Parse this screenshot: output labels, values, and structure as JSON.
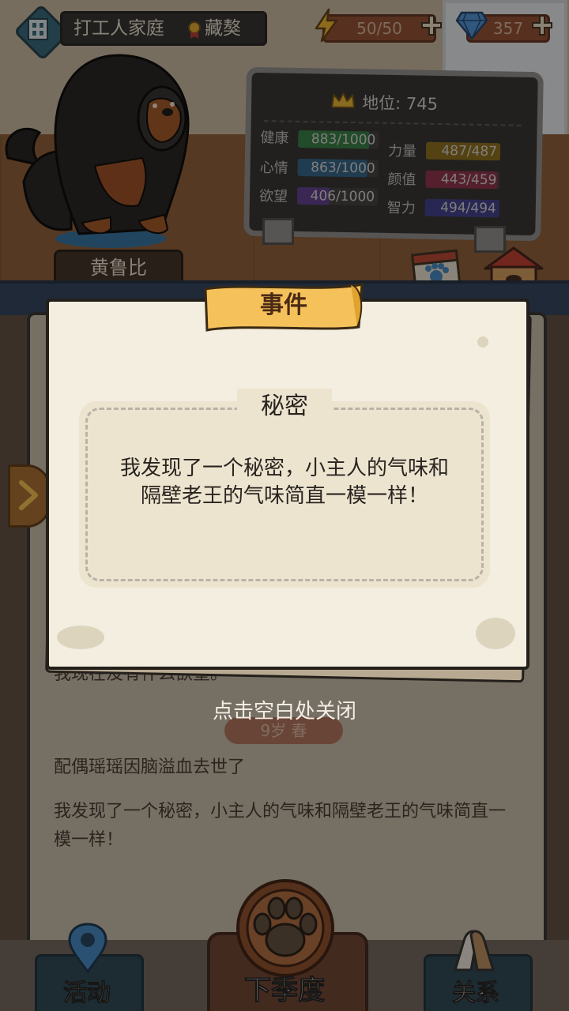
{
  "topbar": {
    "family_name": "打工人家庭",
    "breed": "藏獒",
    "energy": "50/50",
    "gems": "357"
  },
  "dog": {
    "name": "黄鲁比"
  },
  "stats": {
    "status_label": "地位: 745",
    "rows": [
      {
        "label": "健康",
        "value": "883/1000",
        "fraction": 0.883,
        "color": "#2f7a3e"
      },
      {
        "label": "力量",
        "value": "487/487",
        "fraction": 1.0,
        "color": "#8a6a14"
      },
      {
        "label": "心情",
        "value": "863/1000",
        "fraction": 0.863,
        "color": "#2b5f86"
      },
      {
        "label": "颜值",
        "value": "443/459",
        "fraction": 0.965,
        "color": "#8a2a45"
      },
      {
        "label": "欲望",
        "value": "406/1000",
        "fraction": 0.406,
        "color": "#5a3a8a"
      },
      {
        "label": "智力",
        "value": "494/494",
        "fraction": 1.0,
        "color": "#3a3a8a"
      }
    ]
  },
  "side_buttons": {
    "tasks": "任务",
    "kennel": "狗窝"
  },
  "log": {
    "line1": "我现在没有什么欲望。",
    "age_pill": "9岁 春",
    "line2": "配偶瑶瑶因脑溢血去世了",
    "line3": "我发现了一个秘密，小主人的气味和隔壁老王的气味简直一模一样！"
  },
  "bottom_nav": {
    "activity": "活动",
    "next_season": "下季度",
    "relations": "关系"
  },
  "dialog": {
    "title": "事件",
    "heading": "秘密",
    "body": "我发现了一个秘密，小主人的气味和隔壁老王的气味简直一模一样！",
    "close_hint": "点击空白处关闭"
  }
}
